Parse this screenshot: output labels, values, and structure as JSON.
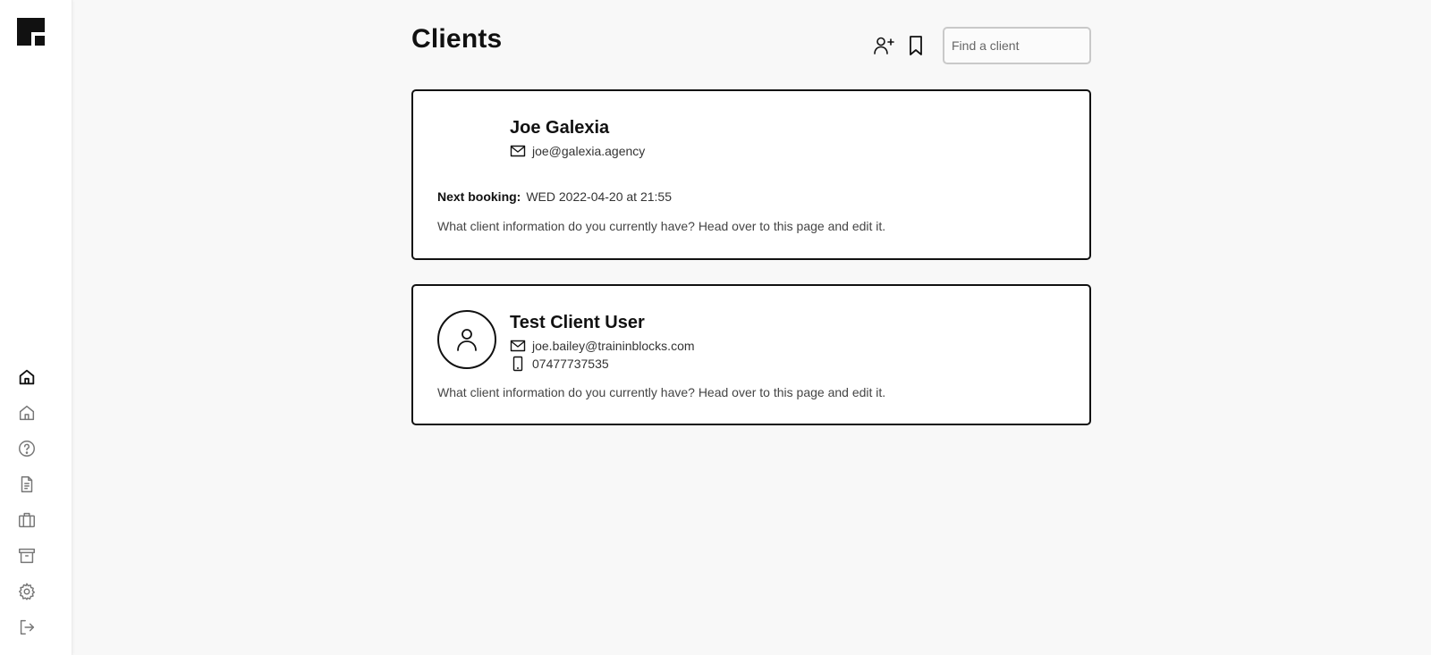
{
  "app": {
    "logo_icon": "brand-logo"
  },
  "sidebar": {
    "items": [
      {
        "name": "home-active",
        "icon": "home-icon"
      },
      {
        "name": "home",
        "icon": "home-outline-icon"
      },
      {
        "name": "help",
        "icon": "help-circle-icon"
      },
      {
        "name": "documents",
        "icon": "document-icon"
      },
      {
        "name": "clients",
        "icon": "briefcase-icon"
      },
      {
        "name": "archive",
        "icon": "archive-icon"
      },
      {
        "name": "settings",
        "icon": "gear-icon"
      },
      {
        "name": "logout",
        "icon": "logout-icon"
      }
    ]
  },
  "header": {
    "title": "Clients",
    "add_client_icon": "add-user-icon",
    "bookmark_icon": "bookmark-icon",
    "search_placeholder": "Find a client",
    "search_value": ""
  },
  "clients": [
    {
      "name": "Joe Galexia",
      "email": "joe@galexia.agency",
      "next_booking_label": "Next booking:",
      "next_booking_value": "WED 2022-04-20 at 21:55",
      "info": "What client information do you currently have? Head over to this page and edit it."
    },
    {
      "name": "Test Client User",
      "email": "joe.bailey@traininblocks.com",
      "phone": "07477737535",
      "avatar_icon": "user-icon",
      "info": "What client information do you currently have? Head over to this page and edit it."
    }
  ],
  "colors": {
    "background": "#f8f8f8",
    "card_border": "#111111",
    "text": "#111111",
    "muted": "#444444"
  }
}
